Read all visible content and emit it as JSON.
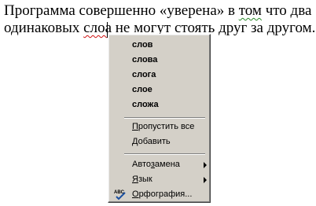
{
  "document": {
    "line1": {
      "part1": "Программа совершенно «уверена» в ",
      "part2": "том",
      "part3": " что два"
    },
    "line2": {
      "part1": "одинаковых ",
      "part2": "слоа",
      "part3": " не могут стоять друг за другом."
    }
  },
  "context_menu": {
    "suggestions": [
      "слов",
      "слова",
      "слога",
      "слое",
      "сложа"
    ],
    "ignore_all": {
      "pre": "",
      "hot": "П",
      "post": "ропустить все"
    },
    "add": {
      "pre": "",
      "hot": "Д",
      "post": "обавить"
    },
    "autocorrect": {
      "pre": "Авто",
      "hot": "з",
      "post": "амена"
    },
    "language": {
      "pre": "",
      "hot": "Я",
      "post": "зык"
    },
    "spelling": {
      "pre": "",
      "hot": "О",
      "post": "рфография..."
    },
    "spelling_icon_text": "ABC"
  }
}
